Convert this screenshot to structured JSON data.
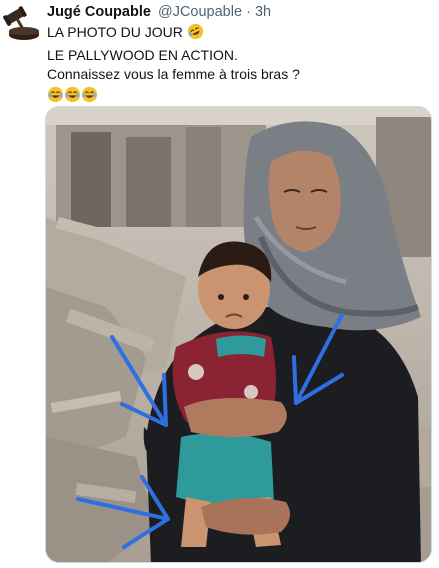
{
  "tweet": {
    "author_name": "Jugé Coupable",
    "handle": "@JCoupable",
    "separator": "·",
    "time": "3h",
    "text_lines": [
      "LA PHOTO DU JOUR",
      "LE PALLYWOOD EN ACTION.",
      "Connaissez vous la femme à trois bras ?"
    ],
    "line1_emoji": "rolling-on-floor-laughing-emoji",
    "line4_emoji": "tears-of-joy-emoji",
    "line4_emoji_count": 3
  },
  "avatar": {
    "icon": "gavel-icon"
  },
  "media": {
    "icon_arrows": "blue-arrow-annotations",
    "arrow_color": "#2f6fe0"
  },
  "colors": {
    "text": "#0f1419",
    "secondary_text": "#536471",
    "emoji_face": "#f6c12c",
    "hijab": "#7a7f86",
    "clothing": "#1c1d21",
    "child_shirt": "#8b2332",
    "child_shorts": "#2f9a9c"
  }
}
